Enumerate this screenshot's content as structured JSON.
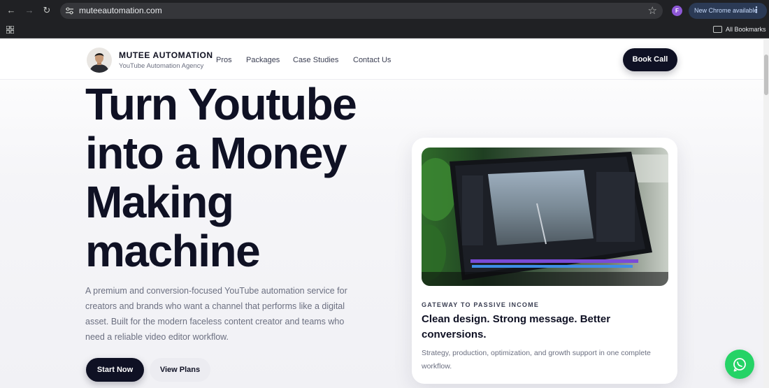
{
  "browser": {
    "url": "muteeautomation.com",
    "profile_initial": "F",
    "update_label": "New Chrome available",
    "bookmarks_label": "All Bookmarks"
  },
  "header": {
    "brand_name": "MUTEE AUTOMATION",
    "brand_tagline": "YouTube Automation Agency",
    "nav": [
      "Pros",
      "Packages",
      "Case Studies",
      "Contact Us"
    ],
    "cta": "Book Call"
  },
  "hero": {
    "title_lines": [
      "Turn Youtube",
      "into a Money",
      "Making",
      "machine"
    ],
    "description": "A premium and conversion-focused YouTube automation service for creators and brands who want a channel that performs like a digital asset. Built for the modern faceless content creator and teams who need a reliable video editor workflow.",
    "primary_button": "Start Now",
    "secondary_button": "View Plans"
  },
  "card": {
    "eyebrow": "GATEWAY TO PASSIVE INCOME",
    "heading": "Clean design. Strong message. Better conversions.",
    "body": "Strategy, production, optimization, and growth support in one complete workflow."
  },
  "colors": {
    "brand_dark": "#0f1124",
    "accent_whatsapp": "#25d366",
    "chrome_bar": "#202124"
  }
}
